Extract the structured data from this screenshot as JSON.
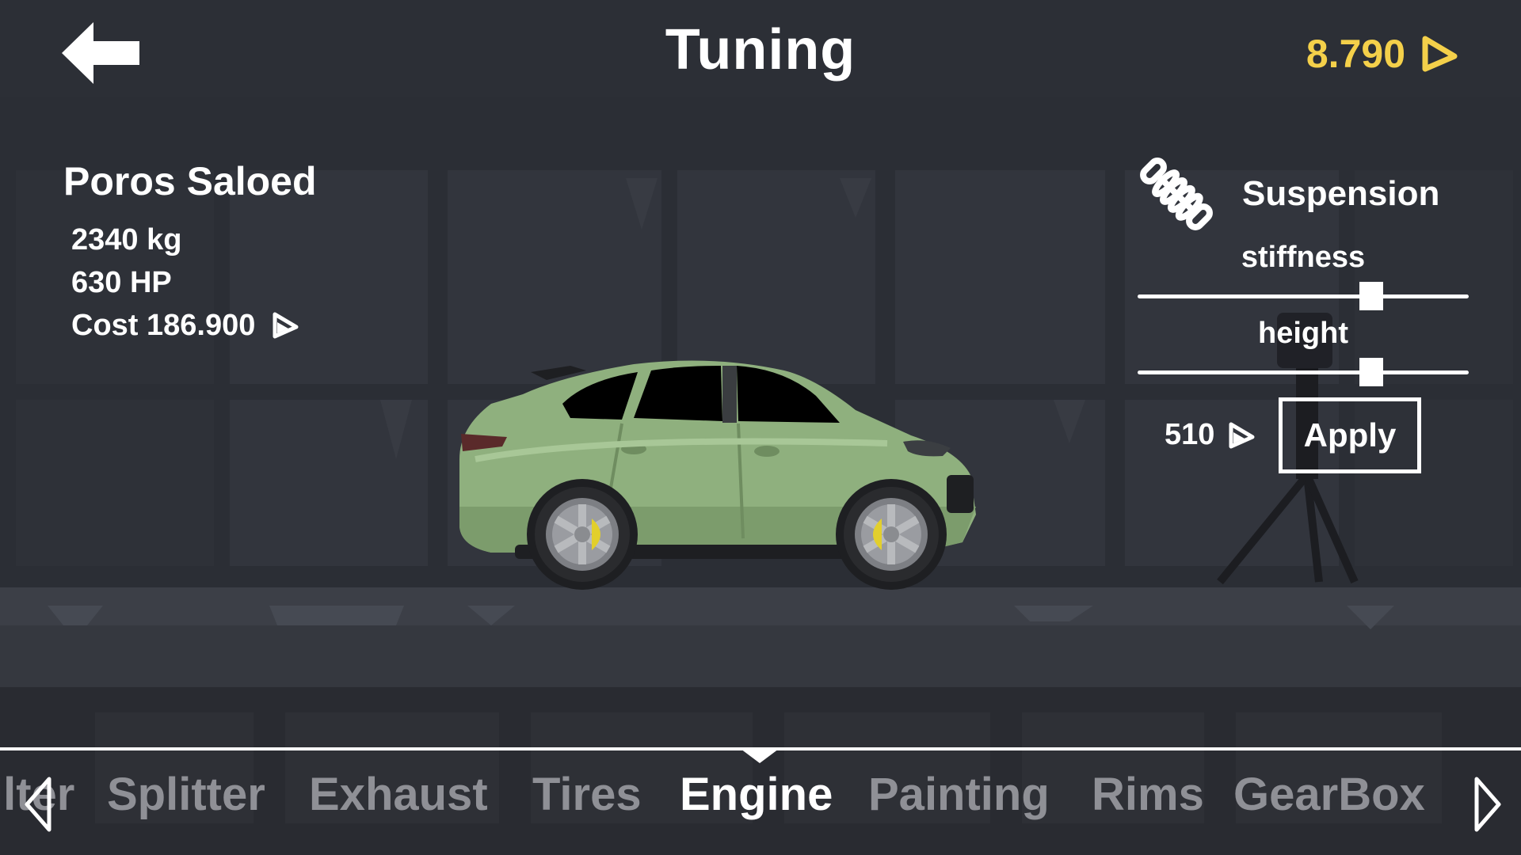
{
  "header": {
    "title": "Tuning",
    "back_icon": "arrow-left-icon",
    "currency_amount": "8.790",
    "currency_icon": "triangle-coin-icon",
    "currency_color": "#f4d04a"
  },
  "car": {
    "name": "Poros Saloed",
    "weight": "2340 kg",
    "power": "630 HP",
    "cost": "Cost 186.900",
    "body_color": "#8fb07e"
  },
  "tuning_panel": {
    "icon": "suspension-spring-icon",
    "title": "Suspension",
    "sliders": [
      {
        "label": "stiffness",
        "value": 0.7
      },
      {
        "label": "height",
        "value": 0.7
      }
    ],
    "price": "510",
    "apply_label": "Apply"
  },
  "tabs": {
    "partial_left": "ilter",
    "items": [
      "Splitter",
      "Exhaust",
      "Tires",
      "Engine",
      "Painting",
      "Rims",
      "GearBox"
    ],
    "active": "Engine"
  }
}
